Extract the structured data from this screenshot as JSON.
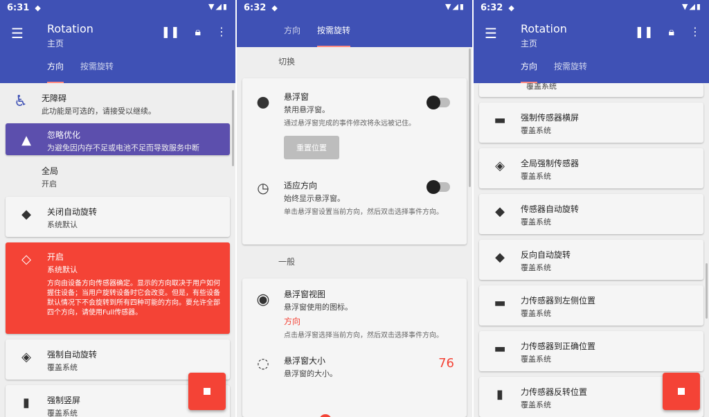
{
  "screen1": {
    "time": "6:31",
    "title": "Rotation",
    "subtitle": "主页",
    "tabs": [
      "方向",
      "按需旋转"
    ],
    "items": [
      {
        "title": "无障碍",
        "sub": "此功能是可选的，请接受以继续。"
      },
      {
        "title": "忽略优化",
        "sub": "为避免因内存不足或电池不足而导致服务中断"
      },
      {
        "title": "全局",
        "sub": "开启"
      },
      {
        "title": "关闭自动旋转",
        "sub": "系统默认"
      },
      {
        "title": "开启",
        "sub": "系统默认",
        "desc": "方向由设备方向传感器确定。显示的方向取决于用户如何握住设备；当用户旋转设备时它会改变。但是，有些设备默认情况下不会旋转到所有四种可能的方向。要允许全部四个方向，请使用Full传感器。"
      },
      {
        "title": "强制自动旋转",
        "sub": "覆盖系统"
      },
      {
        "title": "强制竖屏",
        "sub": "覆盖系统"
      }
    ],
    "colors": {
      "appbar": "#3f51b5",
      "warning": "#5c4fad",
      "active": "#f44336"
    }
  },
  "screen2": {
    "time": "6:32",
    "tabs": [
      "方向",
      "按需旋转"
    ],
    "section1": "切换",
    "floating": {
      "title": "悬浮窗",
      "sub": "禁用悬浮窗。",
      "desc": "通过悬浮窗完成的事件修改将永远被记住。",
      "button": "重置位置"
    },
    "adapt": {
      "title": "适应方向",
      "sub": "始终显示悬浮窗。",
      "desc": "单击悬浮窗设置当前方向，然后双击选择事件方向。"
    },
    "section2": "一般",
    "view": {
      "title": "悬浮窗视图",
      "sub": "悬浮窗使用的图标。",
      "value": "方向",
      "desc": "点击悬浮窗选择当前方向，然后双击选择事件方向。"
    },
    "size": {
      "title": "悬浮窗大小",
      "sub": "悬浮窗的大小。",
      "value": "76"
    },
    "slider": {
      "left": "‹",
      "right": "›",
      "level": 0.3
    }
  },
  "screen3": {
    "time": "6:32",
    "title": "Rotation",
    "subtitle": "主页",
    "tabs": [
      "方向",
      "按需旋转"
    ],
    "top_partial": "覆盖系统",
    "items": [
      {
        "title": "强制传感器横屏",
        "sub": "覆盖系统"
      },
      {
        "title": "全局强制传感器",
        "sub": "覆盖系统"
      },
      {
        "title": "传感器自动旋转",
        "sub": "覆盖系统"
      },
      {
        "title": "反向自动旋转",
        "sub": "覆盖系统"
      },
      {
        "title": "力传感器到左侧位置",
        "sub": "覆盖系统"
      },
      {
        "title": "力传感器到正确位置",
        "sub": "覆盖系统"
      },
      {
        "title": "力传感器反转位置",
        "sub": "覆盖系统"
      }
    ]
  }
}
